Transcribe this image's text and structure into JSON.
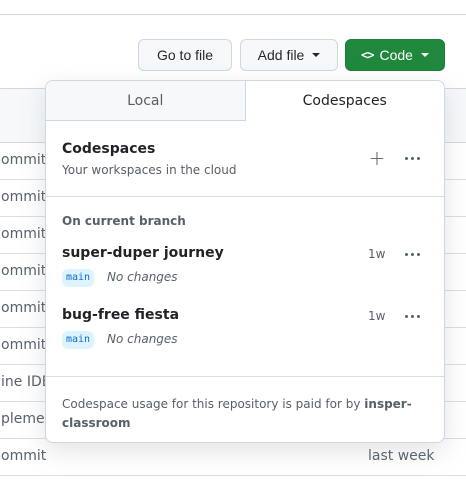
{
  "toolbar": {
    "goto_label": "Go to file",
    "add_label": "Add file",
    "code_label": "Code",
    "code_glyph": "<>"
  },
  "commits": [
    {
      "text": "ommit",
      "time": ""
    },
    {
      "text": "ommit",
      "time": ""
    },
    {
      "text": "ommit",
      "time": ""
    },
    {
      "text": "ommit",
      "time": ""
    },
    {
      "text": "ommit",
      "time": ""
    },
    {
      "text": "ommit",
      "time": ""
    },
    {
      "text": "ine IDE",
      "time": ""
    },
    {
      "text": "plemen",
      "time": ""
    },
    {
      "text": "ommit",
      "time": "last week"
    }
  ],
  "dropdown": {
    "tabs": [
      {
        "label": "Local"
      },
      {
        "label": "Codespaces"
      }
    ],
    "header": {
      "title": "Codespaces",
      "subtitle": "Your workspaces in the cloud",
      "plus_icon": "+"
    },
    "section_label": "On current branch",
    "items": [
      {
        "name": "super-duper journey",
        "age": "1w",
        "branch": "main",
        "status": "No changes"
      },
      {
        "name": "bug-free fiesta",
        "age": "1w",
        "branch": "main",
        "status": "No changes"
      }
    ],
    "footer": {
      "text": "Codespace usage for this repository is paid for by",
      "owner": "insper-classroom"
    }
  },
  "colors": {
    "code_button": "#1f883d",
    "branch_tag_bg": "#ddf4ff",
    "branch_tag_fg": "#0969da"
  }
}
